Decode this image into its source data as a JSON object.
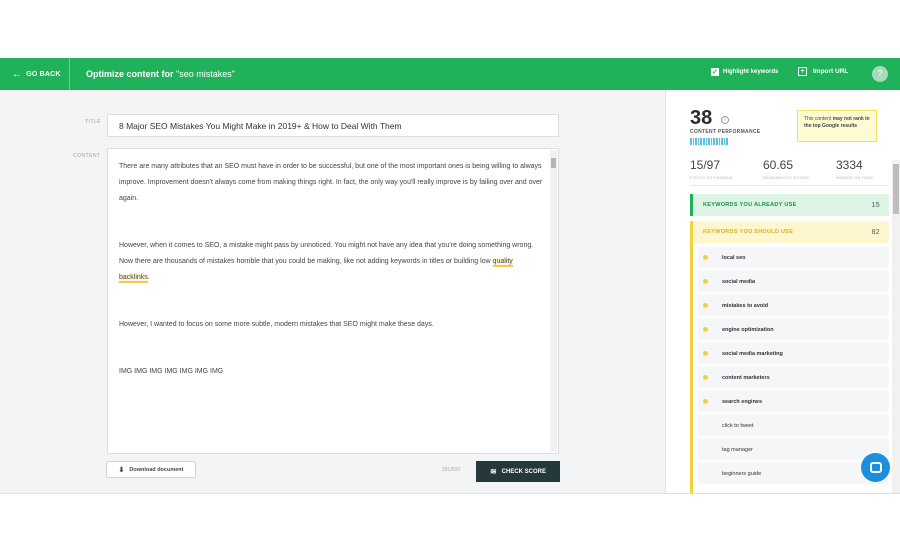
{
  "topbar": {
    "go_back": "GO BACK",
    "title_prefix": "Optimize content for ",
    "title_keyword": "\"seo mistakes\"",
    "highlight_label": "Highlight keywords",
    "import_label": "Import URL",
    "help": "?"
  },
  "editor": {
    "title_label": "TITLE",
    "title_value": "8 Major SEO Mistakes You Might Make in 2019+ & How to Deal With Them",
    "content_label": "CONTENT",
    "p1": "There are many attributes that an SEO must have in order to be successful, but one of the most important ones is being willing to always improve. Improvement doesn't always come from making things right. In fact, the only way you'll really improve is by failing over and over again.",
    "p2_before": "However, when it comes to SEO, a mistake might pass by unnoticed. You might not have any idea that you're doing something wrong. Now there are thousands of mistakes horrible that you could be making, like not adding keywords in titles or building low ",
    "p2_link": "quality backlinks",
    "p2_after": ".",
    "p3": "However, I wanted to focus on some more subtle, modern mistakes that SEO might make these days.",
    "p4": "IMG IMG IMG IMG IMG IMG IMG",
    "download": "Download document",
    "word_count": "291/500",
    "check_score": "CHECK SCORE"
  },
  "panel": {
    "score": "38",
    "score_label": "CONTENT PERFORMANCE",
    "warning_pre": "This content ",
    "warning_bold": "may not rank in the top Google results",
    "stats": [
      {
        "value": "15/97",
        "label": "FOCUS KEYWORDS"
      },
      {
        "value": "60.65",
        "label": "READABILITY SCORE"
      },
      {
        "value": "3334",
        "label": "WORDS ON PAGE"
      }
    ],
    "kw_have_label": "KEYWORDS YOU ALREADY USE",
    "kw_have_count": "15",
    "kw_should_label": "KEYWORDS YOU SHOULD USE",
    "kw_should_count": "82",
    "keywords": [
      {
        "text": "local seo",
        "dot": true
      },
      {
        "text": "social media",
        "dot": true
      },
      {
        "text": "mistakes to avoid",
        "dot": true
      },
      {
        "text": "engine optimization",
        "dot": true
      },
      {
        "text": "social media marketing",
        "dot": true
      },
      {
        "text": "content marketers",
        "dot": true
      },
      {
        "text": "search engines",
        "dot": true
      },
      {
        "text": "click to tweet",
        "dot": false
      },
      {
        "text": "tag manager",
        "dot": false
      },
      {
        "text": "beginners guide",
        "dot": false
      }
    ]
  }
}
